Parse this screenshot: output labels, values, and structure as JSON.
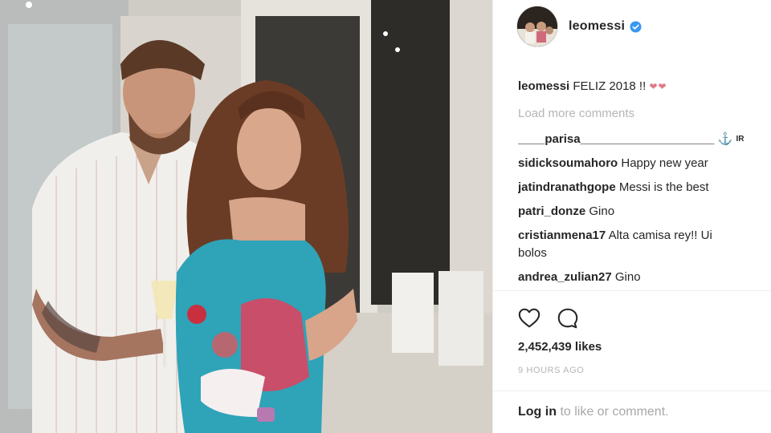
{
  "post": {
    "username": "leomessi",
    "caption_user": "leomessi",
    "caption_text": "FELIZ 2018 !!",
    "load_more": "Load more comments",
    "comments": [
      {
        "user": "____parisa____________________",
        "text": ""
      },
      {
        "user": "sidicksoumahoro",
        "text": "Happy new year"
      },
      {
        "user": "jatindranathgope",
        "text": "Messi is the best"
      },
      {
        "user": "patri_donze",
        "text": "Gino"
      },
      {
        "user": "cristianmena17",
        "text": "Alta camisa rey!! Ui"
      },
      {
        "user": "",
        "text": "bolos"
      },
      {
        "user": "andrea_zulian27",
        "text": "Gino"
      }
    ],
    "emoji_ir": "IR",
    "likes": "2,452,439 likes",
    "time_ago": "9 HOURS AGO",
    "login_link": "Log in",
    "login_text": "to like or comment."
  },
  "icons": {
    "verified": "verified-badge-icon",
    "like": "heart-icon",
    "comment": "comment-bubble-icon"
  },
  "colors": {
    "verified": "#3897f0",
    "text": "#262626",
    "muted": "#b5b5b5"
  }
}
